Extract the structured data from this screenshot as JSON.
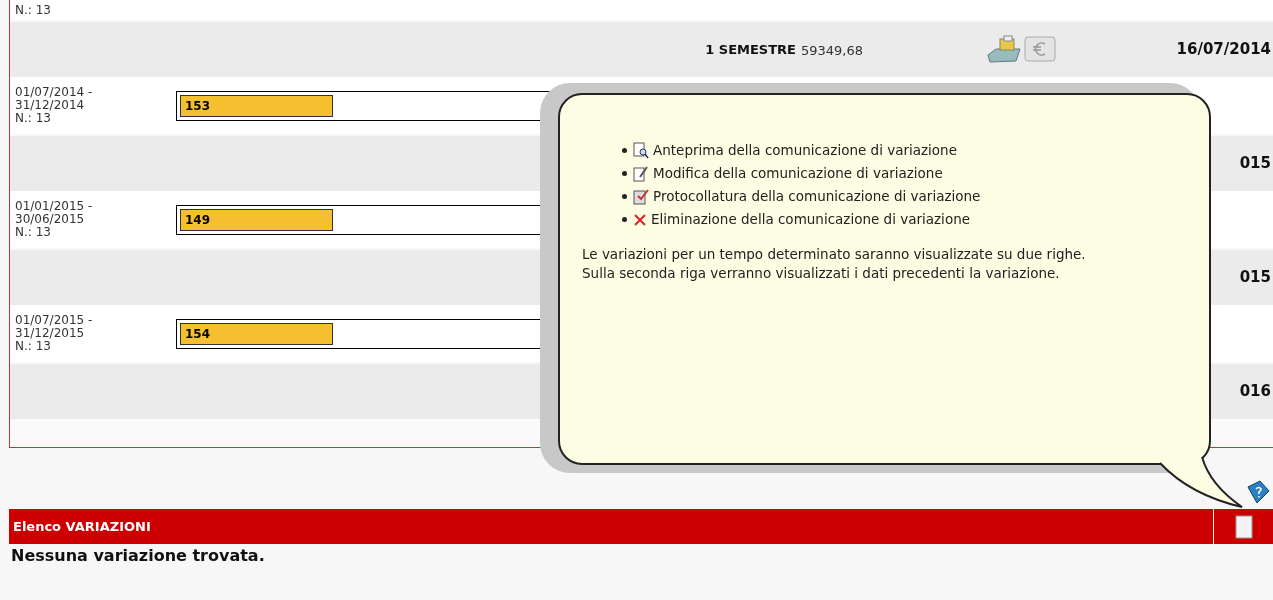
{
  "rows": [
    {
      "kind": "period",
      "lines": [
        "N.: 13"
      ]
    },
    {
      "kind": "summary",
      "label": "1 SEMESTRE",
      "amount": "59349,68",
      "date": "16/07/2014",
      "icons": true
    },
    {
      "kind": "period",
      "lines": [
        "01/07/2014 -",
        "31/12/2014",
        "N.: 13"
      ],
      "value": "153"
    },
    {
      "kind": "summary",
      "date": "015"
    },
    {
      "kind": "period",
      "lines": [
        "01/01/2015 -",
        "30/06/2015",
        "N.: 13"
      ],
      "value": "149"
    },
    {
      "kind": "summary",
      "date": "015"
    },
    {
      "kind": "period",
      "lines": [
        "01/07/2015 -",
        "31/12/2015",
        "N.: 13"
      ],
      "value": "154"
    },
    {
      "kind": "summary",
      "date": "016"
    },
    {
      "kind": "blank"
    }
  ],
  "tooltip": {
    "items": [
      {
        "kind": "preview",
        "text": "Anteprima della comunicazione di variazione"
      },
      {
        "kind": "edit",
        "text": "Modifica della comunicazione di variazione"
      },
      {
        "kind": "protocol",
        "text": "Protocollatura della comunicazione di variazione"
      },
      {
        "kind": "delete",
        "text": "Eliminazione della comunicazione di variazione"
      }
    ],
    "note": [
      "Le variazioni per un tempo determinato saranno visualizzate su due righe.",
      "Sulla seconda riga verranno visualizzati i dati precedenti la variazione."
    ]
  },
  "section": {
    "title": "Elenco VARIAZIONI",
    "empty_text": "Nessuna variazione trovata."
  }
}
